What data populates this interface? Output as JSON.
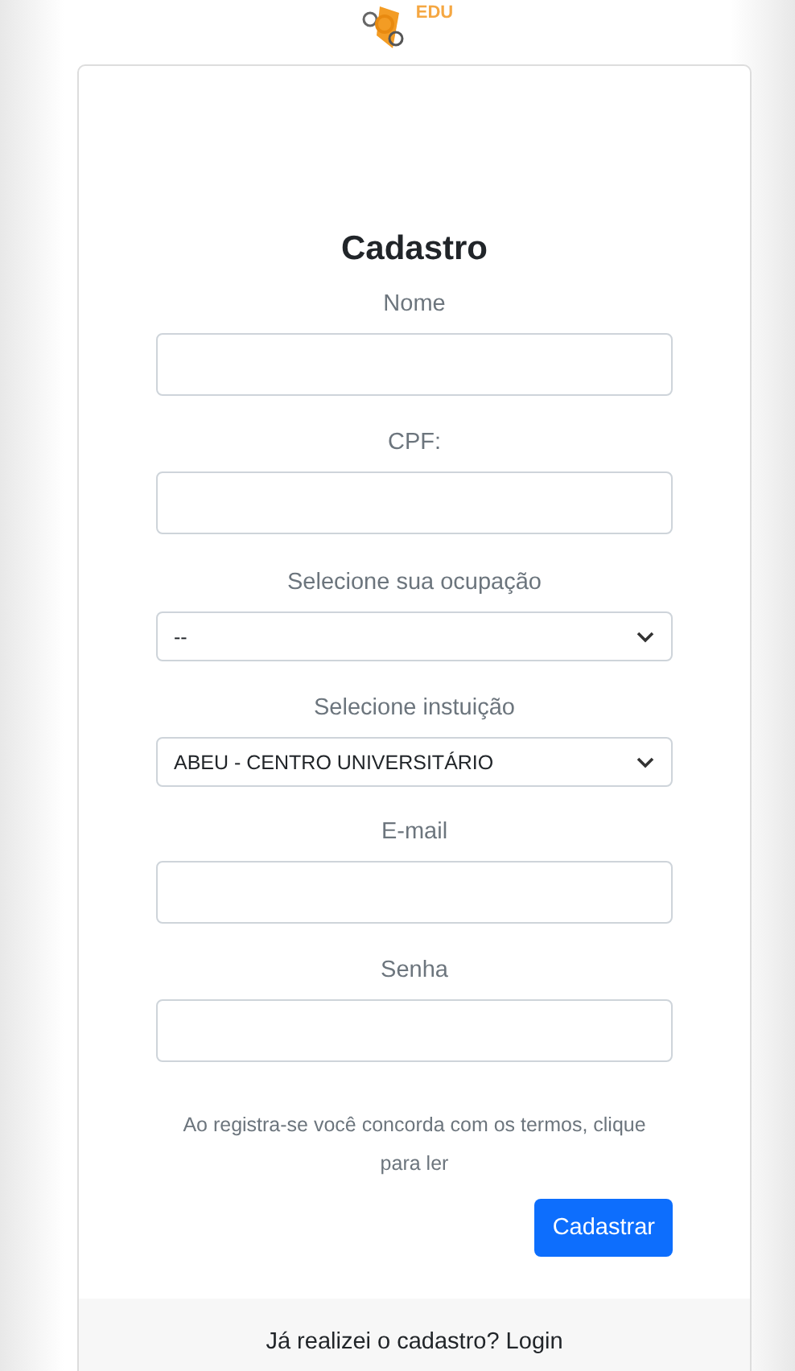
{
  "logo": {
    "text": "EDU"
  },
  "title": "Cadastro",
  "fields": [
    {
      "kind": "text",
      "label": "Nome"
    },
    {
      "kind": "text",
      "label": "CPF:"
    },
    {
      "kind": "select",
      "label": "Selecione sua ocupação",
      "value": "--"
    },
    {
      "kind": "select",
      "label": "Selecione instuição",
      "value": "ABEU - CENTRO UNIVERSITÁRIO"
    },
    {
      "kind": "text",
      "label": "E-mail"
    },
    {
      "kind": "text",
      "label": "Senha"
    }
  ],
  "terms": "Ao registra-se você concorda com os termos, clique para ler",
  "submit": "Cadastrar",
  "footer": "Já realizei o cadastro? Login"
}
